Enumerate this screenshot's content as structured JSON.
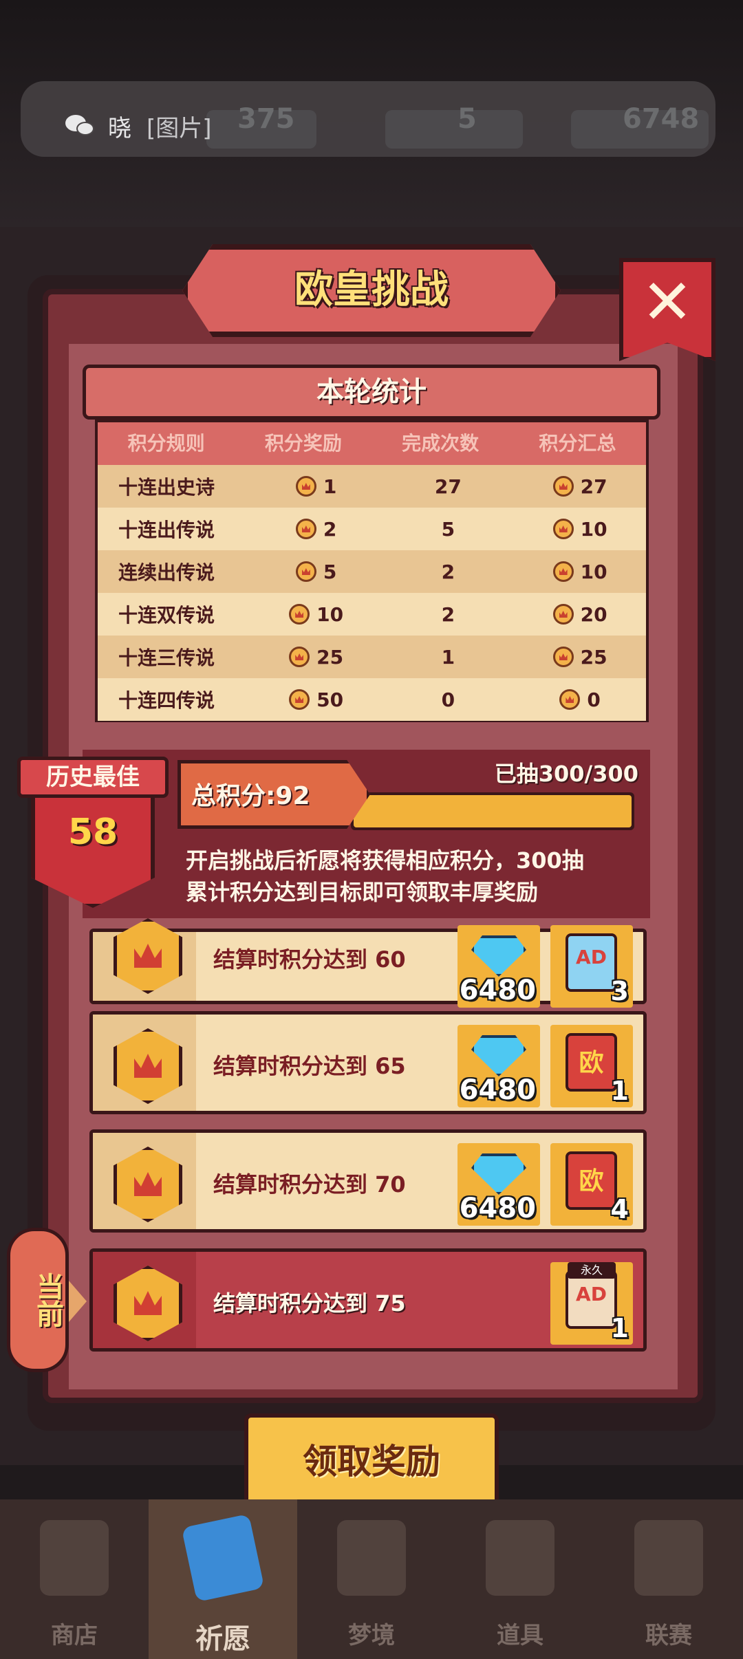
{
  "notification": {
    "sender": "晓",
    "message": "[图片]"
  },
  "resources": [
    {
      "icon": "medal-icon",
      "value": "375"
    },
    {
      "icon": "book-icon",
      "value": "5"
    },
    {
      "icon": "diamond-icon",
      "value": "6748"
    }
  ],
  "panel": {
    "title": "欧皇挑战",
    "subtitle": "本轮统计"
  },
  "stats": {
    "headers": [
      "积分规则",
      "积分奖励",
      "完成次数",
      "积分汇总"
    ],
    "rows": [
      {
        "rule": "十连出史诗",
        "reward": "1",
        "count": "27",
        "total": "27"
      },
      {
        "rule": "十连出传说",
        "reward": "2",
        "count": "5",
        "total": "10"
      },
      {
        "rule": "连续出传说",
        "reward": "5",
        "count": "2",
        "total": "10"
      },
      {
        "rule": "十连双传说",
        "reward": "10",
        "count": "2",
        "total": "20"
      },
      {
        "rule": "十连三传说",
        "reward": "25",
        "count": "1",
        "total": "25"
      },
      {
        "rule": "十连四传说",
        "reward": "50",
        "count": "0",
        "total": "0"
      }
    ]
  },
  "best": {
    "label": "历史最佳",
    "value": "58"
  },
  "score": {
    "total_label": "总积分:92",
    "drawn_label": "已抽300/300",
    "progress": 1.0,
    "description_line1": "开启挑战后祈愿将获得相应积分，300抽",
    "description_line2": "累计积分达到目标即可领取丰厚奖励"
  },
  "rewards": [
    {
      "label": "结算时积分达到 60",
      "gem_count": "6480",
      "item": "ad-card",
      "item_count": "3"
    },
    {
      "label": "结算时积分达到 65",
      "gem_count": "6480",
      "item": "ou-card",
      "item_count": "1"
    },
    {
      "label": "结算时积分达到 70",
      "gem_count": "6480",
      "item": "ou-card",
      "item_count": "4"
    },
    {
      "label": "结算时积分达到 75",
      "item": "ad-card-forever",
      "item_tag": "永久",
      "item_count": "1",
      "current": true
    }
  ],
  "current_tab": "当前",
  "claim_button": "领取奖励",
  "nav": [
    {
      "label": "商店",
      "icon": "shop-icon"
    },
    {
      "label": "祈愿",
      "icon": "wish-icon",
      "active": true
    },
    {
      "label": "梦境",
      "icon": "dream-icon"
    },
    {
      "label": "道具",
      "icon": "item-icon"
    },
    {
      "label": "联赛",
      "icon": "league-icon"
    }
  ],
  "colors": {
    "panel_red": "#7a3138",
    "accent_gold": "#f2b23a",
    "banner_coral": "#d8615f",
    "outline": "#3a1619"
  }
}
